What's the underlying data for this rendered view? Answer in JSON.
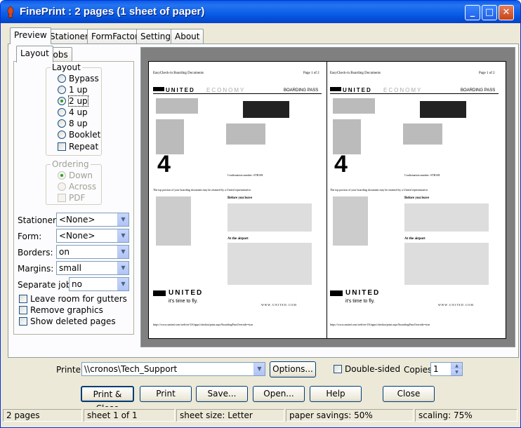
{
  "window": {
    "title": "FinePrint : 2 pages (1 sheet of paper)",
    "min": "_",
    "max": "□",
    "close": "✕"
  },
  "main_tabs": [
    "Preview",
    "Stationery",
    "FormFactory",
    "Settings",
    "About"
  ],
  "sub_tabs": [
    "Layout",
    "Jobs"
  ],
  "layout_group": {
    "title": "Layout",
    "options": [
      "Bypass",
      "1 up",
      "2 up",
      "4 up",
      "8 up",
      "Booklet"
    ],
    "selected": "2 up",
    "repeat_label": "Repeat"
  },
  "ordering_group": {
    "title": "Ordering",
    "options": [
      "Down",
      "Across"
    ],
    "selected": "Down",
    "pdf_label": "PDF"
  },
  "fields": {
    "stationery": {
      "label": "Stationery:",
      "value": "<None>"
    },
    "form": {
      "label": "Form:",
      "value": "<None>"
    },
    "borders": {
      "label": "Borders:",
      "value": "on"
    },
    "margins": {
      "label": "Margins:",
      "value": "small"
    },
    "separate_jobs": {
      "label": "Separate jobs:",
      "value": "no"
    }
  },
  "checks": {
    "leave_room": "Leave room for gutters",
    "remove_graphics": "Remove graphics",
    "show_deleted": "Show deleted pages"
  },
  "doc": {
    "header_left": "EasyCheck-in Boarding Documents",
    "header_right": "Page 1 of 2",
    "header_right2": "Page 1 of 2",
    "airline": "UNITED",
    "class": "ECONOMY",
    "pass": "BOARDING PASS",
    "gate": "4",
    "confirm": "Confirmation number: STHAH",
    "note": "The top portion of your boarding document may be retained by a United representative.",
    "before": "Before you leave",
    "airport": "At the airport",
    "slogan": "it's time to fly.",
    "web": "W W W . U N I T E D . C O M",
    "footer_url": "https://www.united.com/web/en-US/apps/checkin/print.aspx?boardingPassOverride=true"
  },
  "bottom": {
    "printer_label": "Printer:",
    "printer_value": "\\\\cronos\\Tech_Support",
    "options_btn": "Options...",
    "double_sided": "Double-sided",
    "copies_label": "Copies:",
    "copies_value": "1"
  },
  "buttons": [
    "Print & Close",
    "Print",
    "Save...",
    "Open...",
    "Help",
    "Close"
  ],
  "status": {
    "pages": "2 pages",
    "sheet": "sheet 1 of 1",
    "size": "sheet size: Letter",
    "savings": "paper savings: 50%",
    "scaling": "scaling: 75%"
  }
}
